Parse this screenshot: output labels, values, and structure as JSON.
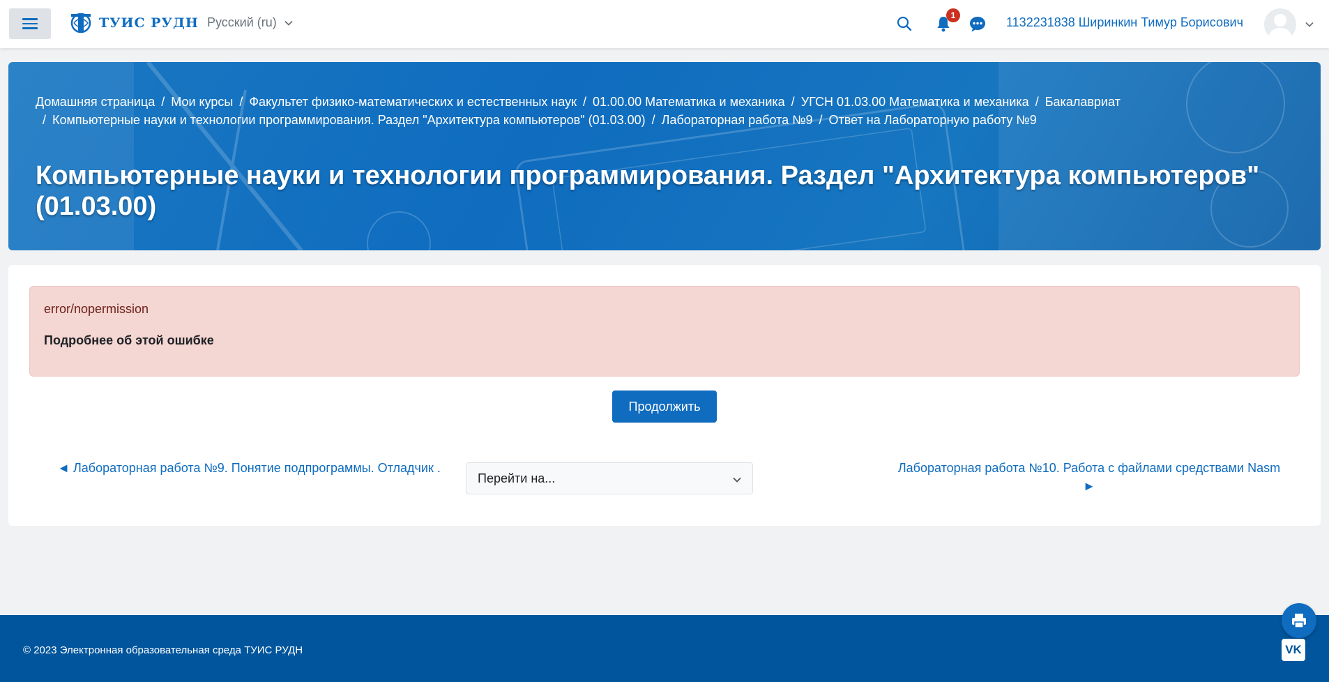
{
  "navbar": {
    "logo_text": "ТУИС РУДН",
    "language": "Русский (ru)",
    "notification_count": "1",
    "user_name": "1132231838 Ширинкин Тимур Борисович"
  },
  "breadcrumb": [
    "Домашняя страница",
    "Мои курсы",
    "Факультет физико-математических и естественных наук",
    "01.00.00 Математика и механика",
    "УГСН 01.03.00 Математика и механика",
    "Бакалавриат",
    "Компьютерные науки и технологии программирования. Раздел \"Архитектура компьютеров\" (01.03.00)",
    "Лабораторная работа №9",
    "Ответ на Лабораторную работу №9"
  ],
  "page": {
    "title": "Компьютерные науки и технологии программирования. Раздел \"Архитектура компьютеров\" (01.03.00)"
  },
  "error": {
    "code": "error/nopermission",
    "more_info": "Подробнее об этой ошибке"
  },
  "actions": {
    "continue_label": "Продолжить"
  },
  "navigation": {
    "prev_label": "◄ Лабораторная работа №9. Понятие подпрограммы. Отладчик .",
    "jump_placeholder": "Перейти на...",
    "next_label": "Лабораторная работа №10. Работа с файлами средствами Nasm ►"
  },
  "footer": {
    "copyright": "© 2023 Электронная образовательная среда ТУИС РУДН",
    "vk_label": "VK"
  },
  "colors": {
    "brand": "#0f6cbf",
    "footer": "#00559c",
    "alert_bg": "#f4d6d2",
    "badge": "#ca3120"
  },
  "icons": [
    "menu-icon",
    "search-icon",
    "bell-icon",
    "chat-icon",
    "chevron-down-icon",
    "printer-icon",
    "vk-icon"
  ]
}
